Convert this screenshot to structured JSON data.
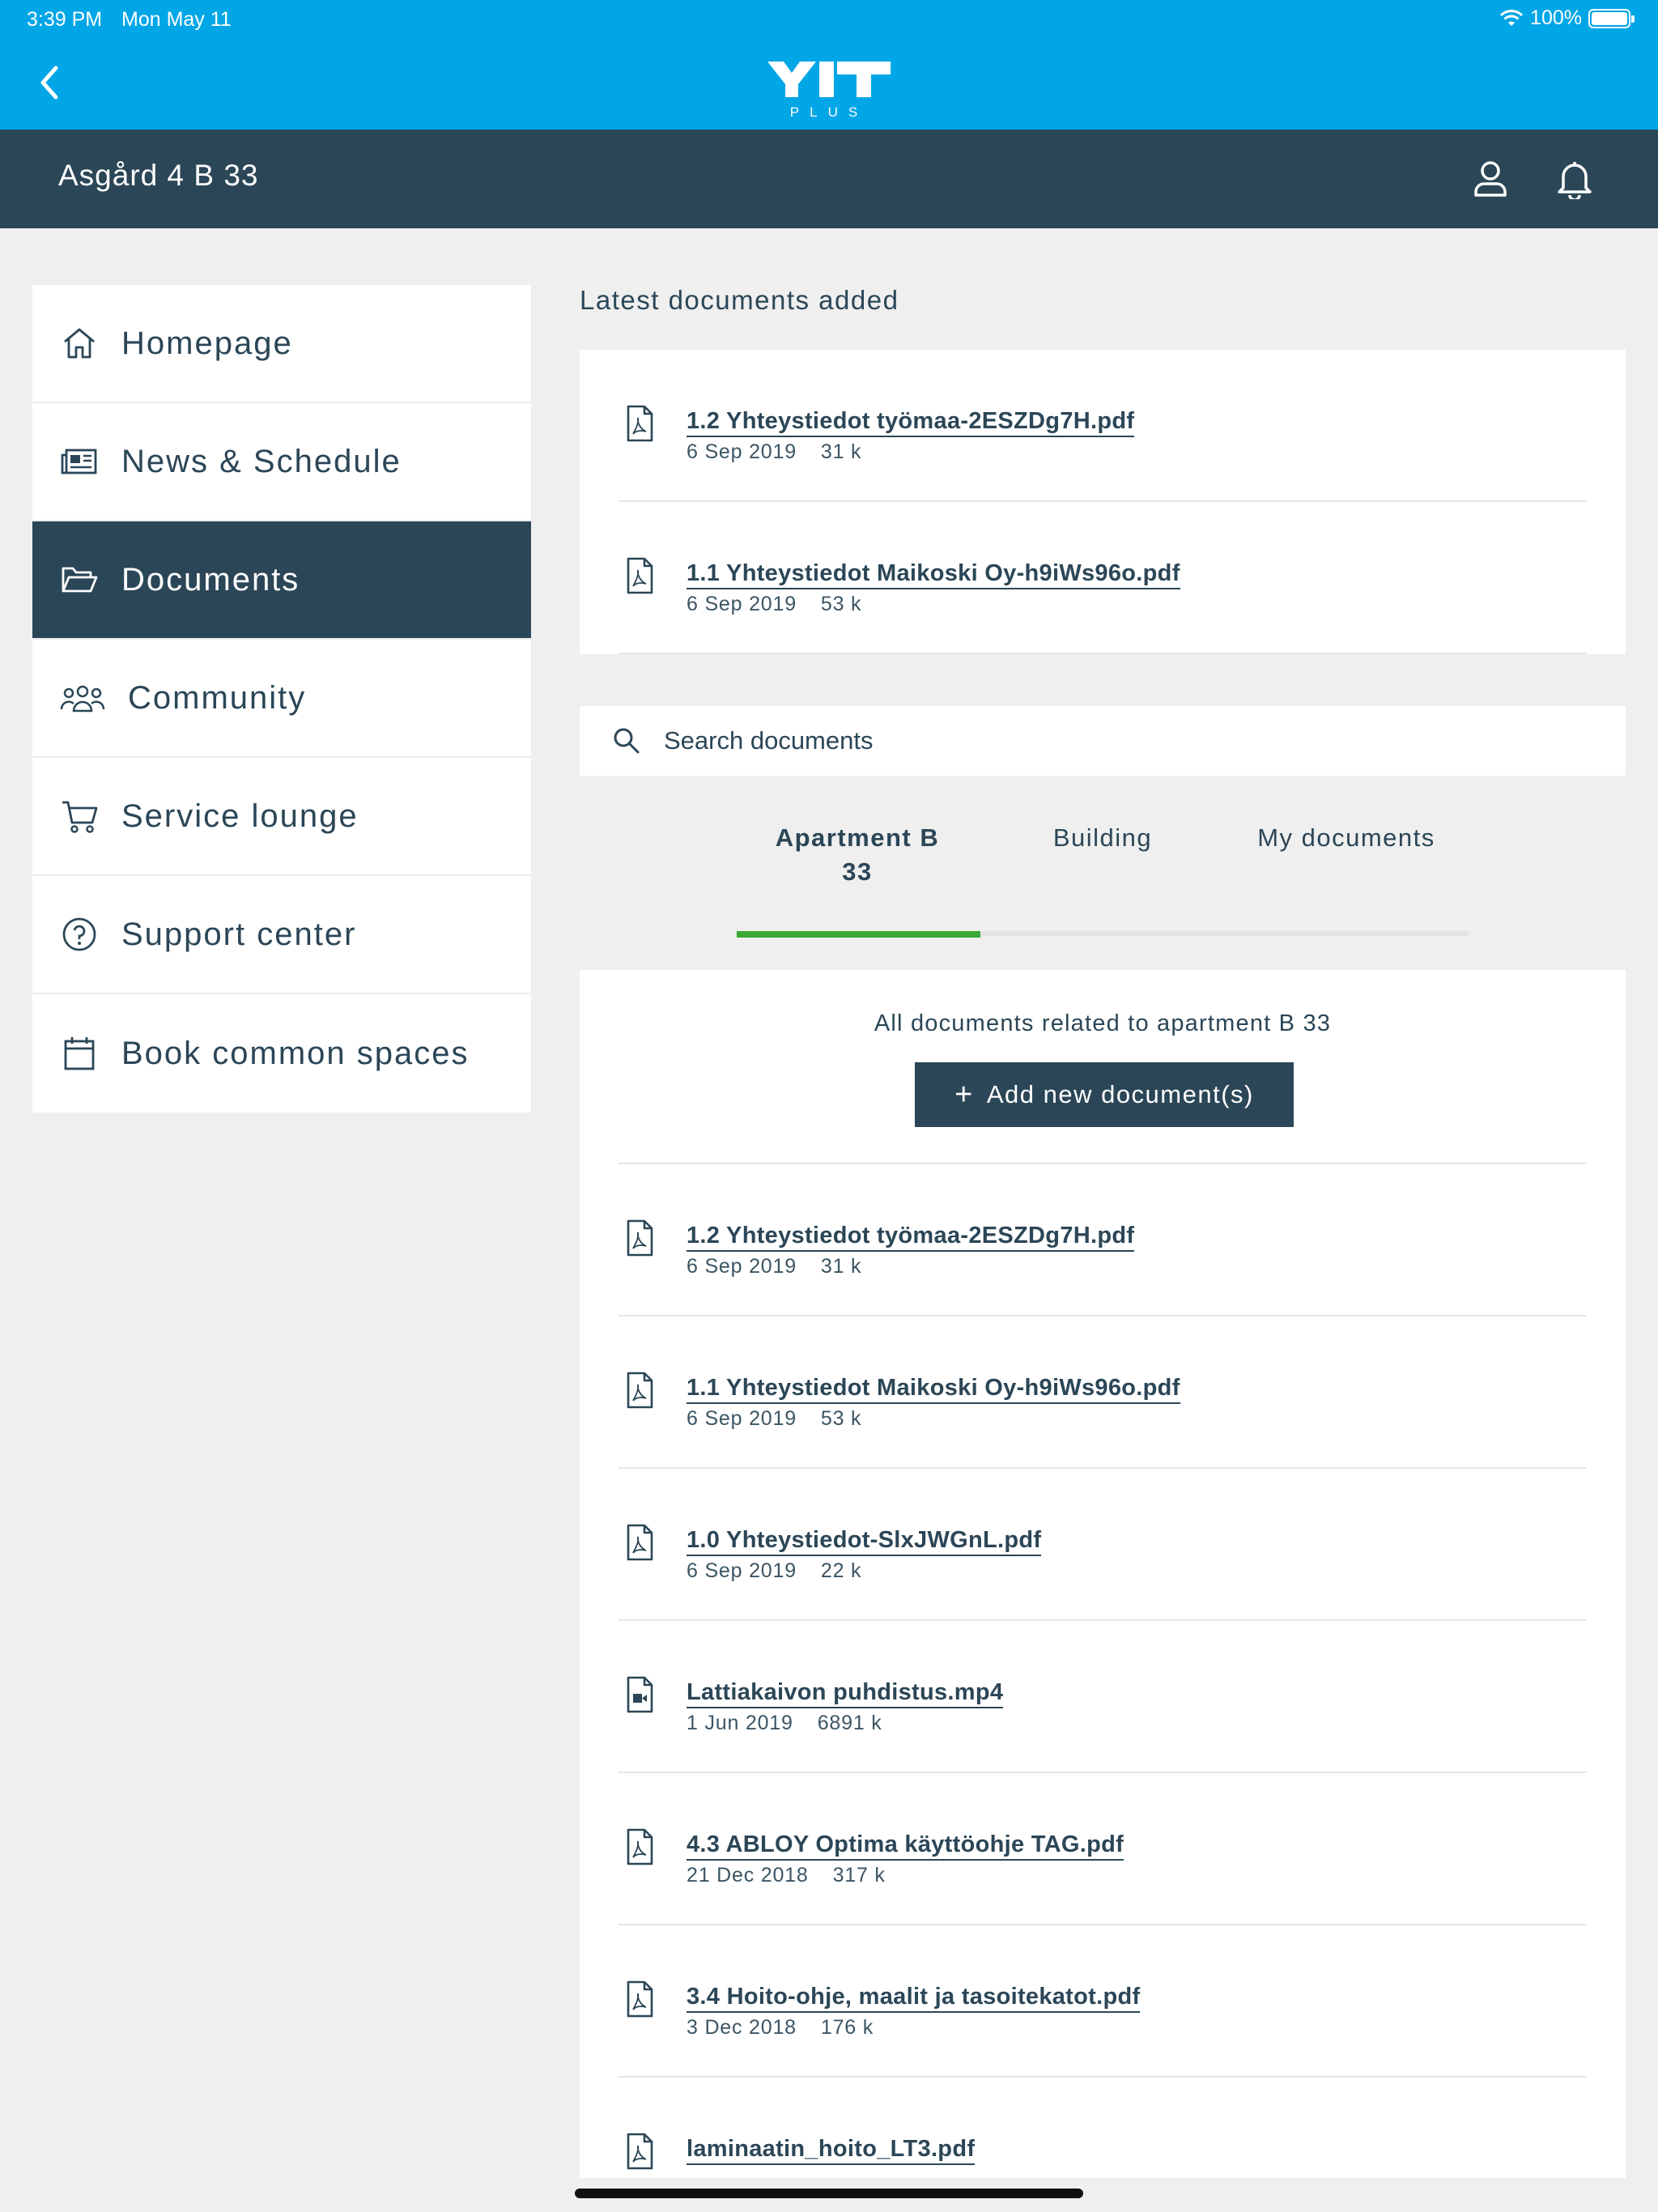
{
  "status_bar": {
    "time": "3:39 PM",
    "date": "Mon May 11",
    "battery": "100%"
  },
  "app": {
    "logo_text": "YIT",
    "logo_sub": "PLUS"
  },
  "header": {
    "location": "Asgård 4  B 33"
  },
  "sidebar": {
    "items": [
      {
        "label": "Homepage",
        "icon": "home-icon"
      },
      {
        "label": "News & Schedule",
        "icon": "newspaper-icon"
      },
      {
        "label": "Documents",
        "icon": "folder-icon",
        "active": true
      },
      {
        "label": "Community",
        "icon": "people-icon"
      },
      {
        "label": "Service lounge",
        "icon": "cart-icon"
      },
      {
        "label": "Support center",
        "icon": "help-icon"
      },
      {
        "label": "Book common spaces",
        "icon": "calendar-icon"
      }
    ]
  },
  "latest": {
    "title": "Latest documents added",
    "docs": [
      {
        "name": "1.2 Yhteystiedot työmaa-2ESZDg7H.pdf",
        "date": "6 Sep 2019",
        "size": "31 k",
        "type": "pdf"
      },
      {
        "name": "1.1 Yhteystiedot Maikoski Oy-h9iWs96o.pdf",
        "date": "6 Sep 2019",
        "size": "53 k",
        "type": "pdf"
      }
    ]
  },
  "search": {
    "placeholder": "Search documents"
  },
  "tabs": [
    {
      "label": "Apartment B\n33",
      "active": true
    },
    {
      "label": "Building"
    },
    {
      "label": "My documents"
    }
  ],
  "documents": {
    "description": "All documents related to apartment B 33",
    "add_button": "Add new document(s)",
    "items": [
      {
        "name": "1.2 Yhteystiedot työmaa-2ESZDg7H.pdf",
        "date": "6 Sep 2019",
        "size": "31 k",
        "type": "pdf"
      },
      {
        "name": "1.1 Yhteystiedot Maikoski Oy-h9iWs96o.pdf",
        "date": "6 Sep 2019",
        "size": "53 k",
        "type": "pdf"
      },
      {
        "name": "1.0 Yhteystiedot-SlxJWGnL.pdf",
        "date": "6 Sep 2019",
        "size": "22 k",
        "type": "pdf"
      },
      {
        "name": "Lattiakaivon puhdistus.mp4",
        "date": "1 Jun 2019",
        "size": "6891 k",
        "type": "video"
      },
      {
        "name": "4.3 ABLOY Optima käyttöohje TAG.pdf",
        "date": "21 Dec 2018",
        "size": "317 k",
        "type": "pdf"
      },
      {
        "name": "3.4 Hoito-ohje, maalit ja tasoitekatot.pdf",
        "date": "3 Dec 2018",
        "size": "176 k",
        "type": "pdf"
      },
      {
        "name": "laminaatin_hoito_LT3.pdf",
        "date": "",
        "size": "",
        "type": "pdf"
      }
    ]
  },
  "colors": {
    "brand_blue": "#00a6e6",
    "navy": "#2b4657",
    "active_tab": "#3aa935"
  }
}
